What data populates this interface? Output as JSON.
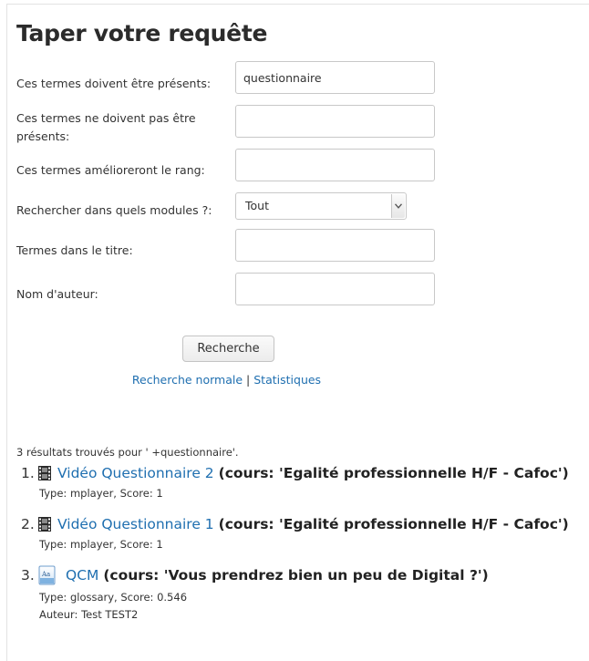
{
  "page_title": "Taper votre requête",
  "form": {
    "must_have_label": "Ces termes doivent être présents:",
    "must_have_value": "questionnaire",
    "must_not_have_label": "Ces termes ne doivent pas être présents:",
    "must_not_have_value": "",
    "rank_label": "Ces termes amélioreront le rang:",
    "rank_value": "",
    "modules_label": "Rechercher dans quels modules ?:",
    "modules_selected": "Tout",
    "title_terms_label": "Termes dans le titre:",
    "title_terms_value": "",
    "author_label": "Nom d'auteur:",
    "author_value": "",
    "search_button_label": "Recherche"
  },
  "links": {
    "normal_search": "Recherche normale",
    "separator": "|",
    "statistics": "Statistiques"
  },
  "results": {
    "summary": "3 résultats trouvés pour ' +questionnaire'.",
    "items": [
      {
        "number": "1.",
        "icon": "video-icon",
        "title": "Vidéo Questionnaire 2",
        "course": "(cours: 'Egalité professionnelle H/F - Cafoc')",
        "meta": "Type: mplayer, Score: 1"
      },
      {
        "number": "2.",
        "icon": "video-icon",
        "title": "Vidéo Questionnaire 1",
        "course": "(cours: 'Egalité professionnelle H/F - Cafoc')",
        "meta": "Type: mplayer, Score: 1"
      },
      {
        "number": "3.",
        "icon": "glossary-icon",
        "title": "QCM",
        "course": "(cours: 'Vous prendrez bien un peu de Digital ?')",
        "meta": "Type: glossary, Score: 0.546",
        "author": "Auteur: Test TEST2"
      }
    ]
  },
  "colors": {
    "link": "#1f6fb0",
    "text": "#333333",
    "heading": "#2b2b2b"
  }
}
